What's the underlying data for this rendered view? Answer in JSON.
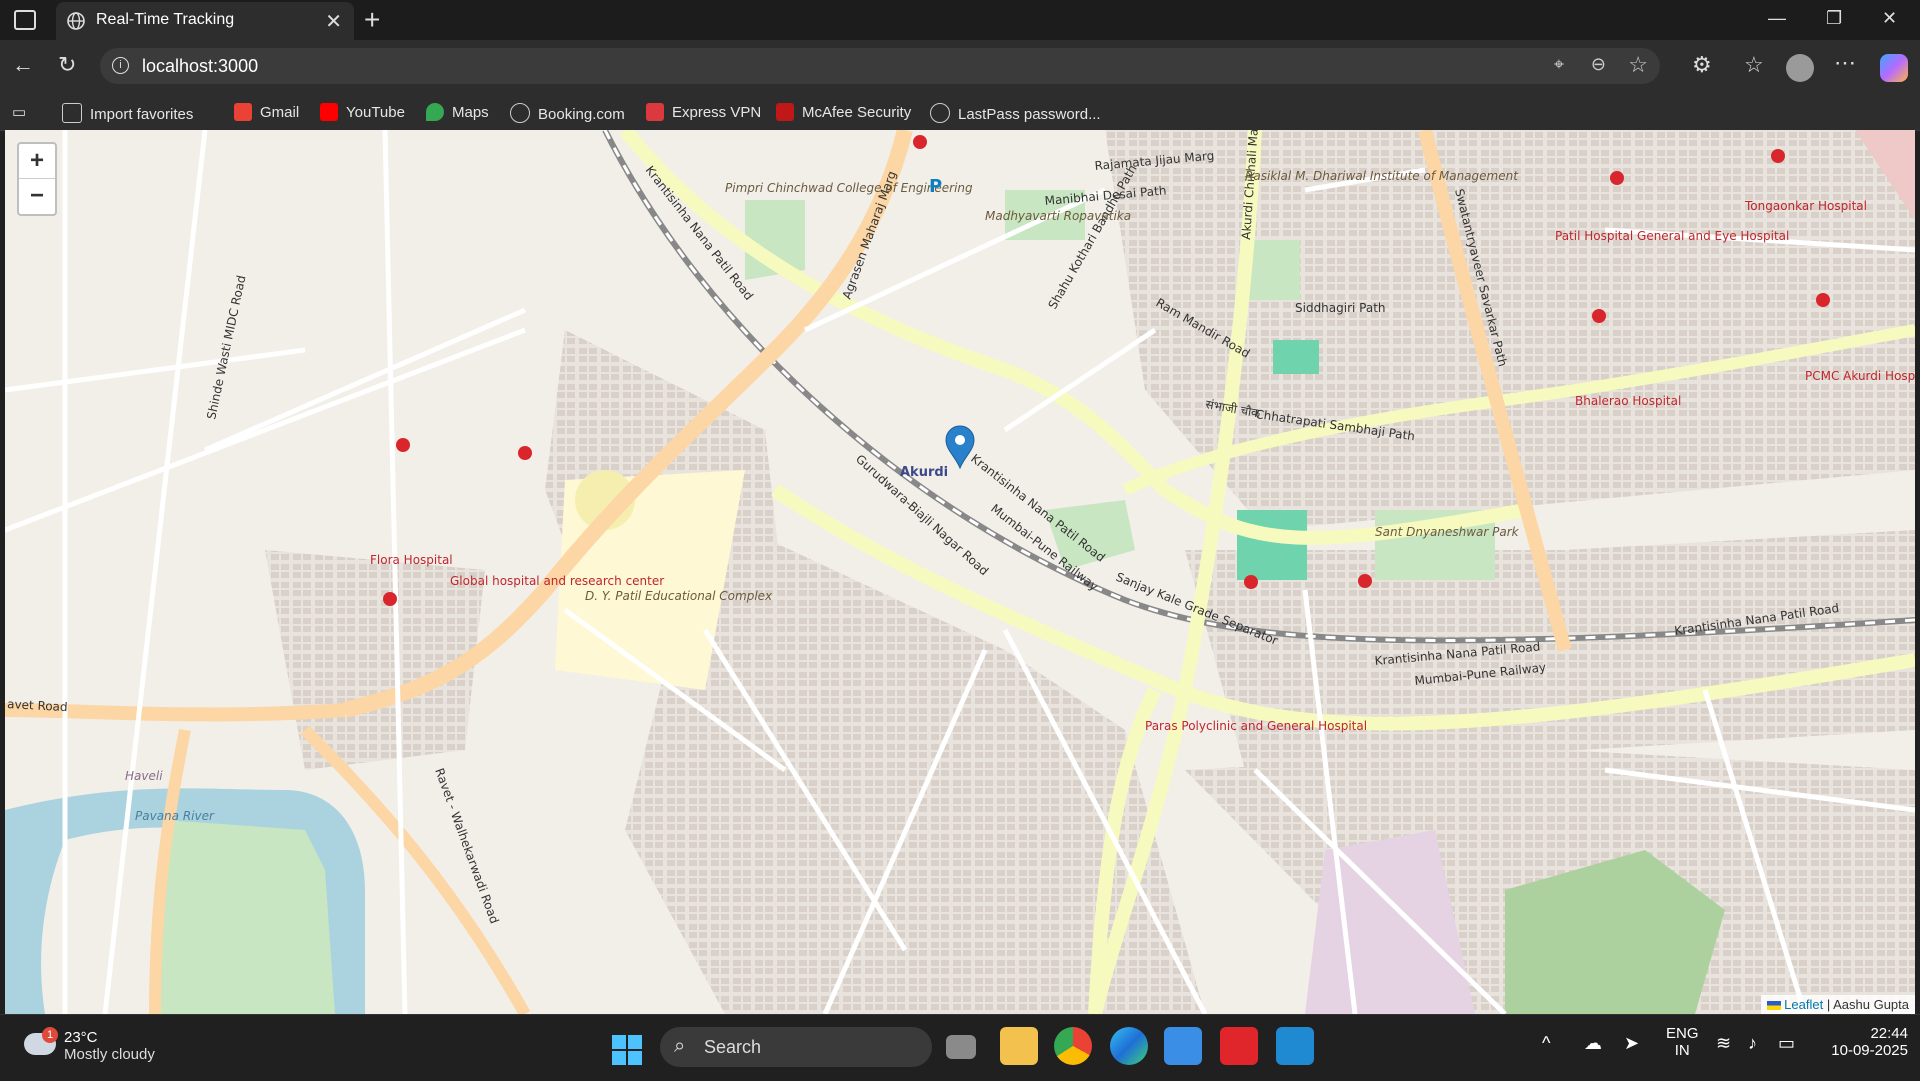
{
  "browser": {
    "tab_title": "Real-Time Tracking",
    "tab_close": "✕",
    "new_tab": "+",
    "url": "localhost:3000",
    "win_min": "—",
    "win_max": "❐",
    "win_close": "✕"
  },
  "favorites": [
    {
      "label": "Import favorites",
      "color": "#cfcfcf"
    },
    {
      "label": "Gmail",
      "color": "#ea4335"
    },
    {
      "label": "YouTube",
      "color": "#ff0000"
    },
    {
      "label": "Maps",
      "color": "#34a853"
    },
    {
      "label": "Booking.com",
      "color": "#cfcfcf"
    },
    {
      "label": "Express VPN",
      "color": "#da3940"
    },
    {
      "label": "McAfee Security",
      "color": "#c01818"
    },
    {
      "label": "LastPass password...",
      "color": "#cfcfcf"
    }
  ],
  "map": {
    "zoom_in": "+",
    "zoom_out": "−",
    "attribution_link": "Leaflet",
    "attribution_sep": " | ",
    "attribution_author": "Aashu Gupta",
    "places": {
      "pimpri": "Pimpri Chinchwad College of Engineering",
      "madhyavarti": "Madhyavarti Ropavatika",
      "rasiklal": "Rasiklal M. Dhariwal Institute of Management",
      "patil_hosp": "Patil Hospital General and Eye Hospital",
      "tongaonkar": "Tongaonkar Hospital",
      "pcmc": "PCMC Akurdi Hospital",
      "bhalerao": "Bhalerao Hospital",
      "akurdi": "Akurdi",
      "flora": "Flora Hospital",
      "global": "Global hospital and research center",
      "dypatil": "D. Y. Patil Educational Complex",
      "sant": "Sant Dnyaneshwar Park",
      "paras": "Paras Polyclinic and General Hospital",
      "haveli": "Haveli",
      "pavana": "Pavana River"
    },
    "roads": {
      "krantisinha1": "Krantisinha Nana Patil Road",
      "krantisinha2": "Krantisinha Nana Patil Road",
      "krantisinha3": "Krantisinha Nana Patil Road",
      "krantisinha4": "Krantisinha Nana Patil Road",
      "agrasen": "Agrasen Maharaj Marg",
      "shinde": "Shinde Wasti MIDC Road",
      "gurudwara": "Gurudwara-Biajli Nagar Road",
      "mumbai_pune1": "Mumbai-Pune Railway",
      "mumbai_pune2": "Mumbai-Pune Railway",
      "sanjay": "Sanjay Kale Grade Separator",
      "chhatrapati": "Chhatrapati Sambhaji Path",
      "sambhaji_chowk": "संभाजी चौक",
      "rajamata": "Rajamata Jijau Marg",
      "manibhai": "Manibhai Desai Path",
      "siddhagiri": "Siddhagiri Path",
      "ram_mandir": "Ram Mandir Road",
      "akurdi_chikhali": "Akurdi Chikhali Marg",
      "swatantryaveer": "Swatantryaveer Savarkar Path",
      "ravet_walhe": "Ravet - Walhekarwadi Road",
      "ravet_road": "avet Road",
      "shahu": "Shahu Kothari Bandhu Path"
    }
  },
  "taskbar": {
    "temp": "23°C",
    "condition": "Mostly cloudy",
    "badge": "1",
    "search": "Search",
    "lang1": "ENG",
    "lang2": "IN",
    "time": "22:44",
    "date": "10-09-2025"
  }
}
